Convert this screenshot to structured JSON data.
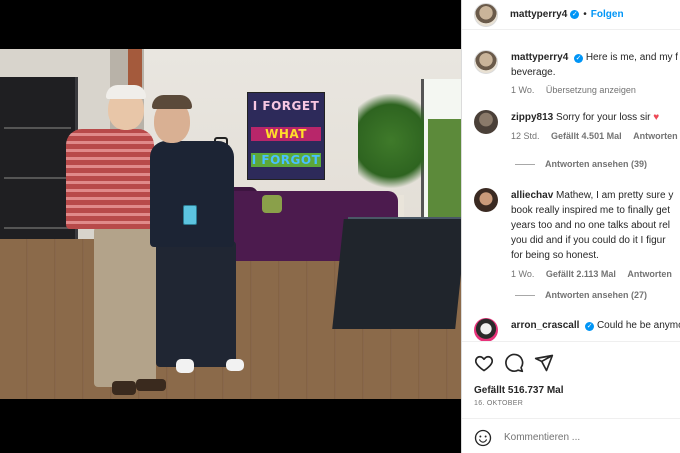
{
  "post_header": {
    "username": "mattyperry4",
    "verified": true,
    "separator": "•",
    "follow_label": "Folgen"
  },
  "artwork": {
    "line1": "I FORGET",
    "line2": "WHAT",
    "line3": "I FORGOT"
  },
  "comments": [
    {
      "username": "mattyperry4",
      "verified": true,
      "text": "Here is me, and my father having a refreshing beverage.",
      "text_line1": "Here is me, and my f",
      "text_line2": "beverage.",
      "time": "1 Wo.",
      "action": "Übersetzung anzeigen"
    },
    {
      "username": "zippy813",
      "text": "Sorry for your loss sir",
      "emoji": "♥",
      "time": "12 Std.",
      "likes": "Gefällt 4.501 Mal",
      "reply": "Antworten",
      "extra": "Ü",
      "view_replies": "Antworten ansehen (39)"
    },
    {
      "username": "alliechav",
      "text_line1": "Mathew, I am pretty sure y",
      "text_line2": "book really inspired me to finally get",
      "text_line3": "years too and no one talks about rel",
      "text_line4": "you did and if you could do it I figur",
      "text_line5": "for being so honest.",
      "time": "1 Wo.",
      "likes": "Gefällt 2.113 Mal",
      "reply": "Antworten",
      "extra": "Ü",
      "view_replies": "Antworten ansehen (27)"
    },
    {
      "username": "arron_crascall",
      "verified": true,
      "text": "Could he be anymo"
    }
  ],
  "actions": {
    "like_icon": "heart-outline-icon",
    "comment_icon": "speech-bubble-icon",
    "share_icon": "paper-plane-icon",
    "likes_count": "Gefällt 516.737 Mal",
    "date": "16. OKTOBER"
  },
  "add_comment": {
    "placeholder": "Kommentieren ..."
  },
  "colors": {
    "accent": "#0095f6",
    "muted": "#737373",
    "heart": "#ed4956"
  }
}
